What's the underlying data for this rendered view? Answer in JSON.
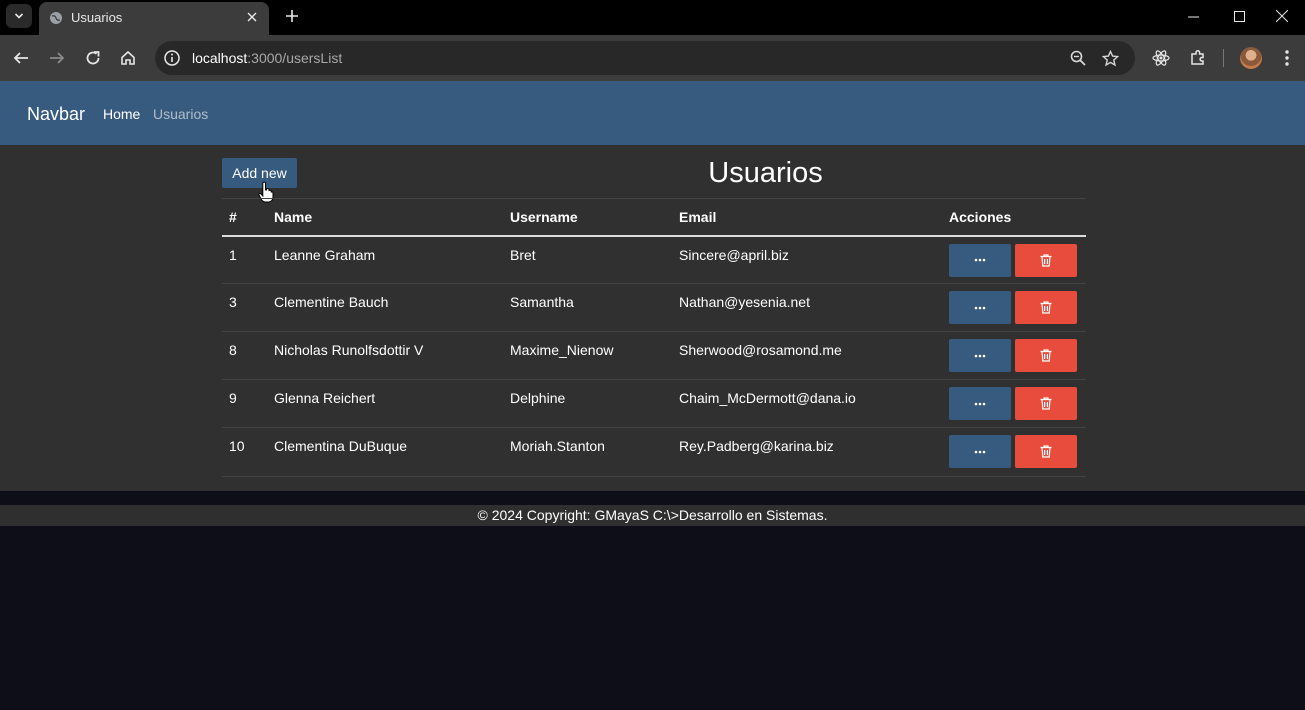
{
  "browser": {
    "tab_title": "Usuarios",
    "url_host": "localhost",
    "url_path": ":3000/usersList"
  },
  "navbar": {
    "brand": "Navbar",
    "links": [
      "Home",
      "Usuarios"
    ]
  },
  "main": {
    "add_button": "Add new",
    "title": "Usuarios",
    "columns": [
      "#",
      "Name",
      "Username",
      "Email",
      "Acciones"
    ],
    "rows": [
      {
        "id": "1",
        "name": "Leanne Graham",
        "username": "Bret",
        "email": "Sincere@april.biz"
      },
      {
        "id": "3",
        "name": "Clementine Bauch",
        "username": "Samantha",
        "email": "Nathan@yesenia.net"
      },
      {
        "id": "8",
        "name": "Nicholas Runolfsdottir V",
        "username": "Maxime_Nienow",
        "email": "Sherwood@rosamond.me"
      },
      {
        "id": "9",
        "name": "Glenna Reichert",
        "username": "Delphine",
        "email": "Chaim_McDermott@dana.io"
      },
      {
        "id": "10",
        "name": "Clementina DuBuque",
        "username": "Moriah.Stanton",
        "email": "Rey.Padberg@karina.biz"
      }
    ],
    "more_button_icon": "ellipsis-icon",
    "delete_button_icon": "trash-icon"
  },
  "footer": {
    "text": "© 2024 Copyright: GMayaS C:\\>Desarrollo en Sistemas."
  },
  "colors": {
    "primary": "#375a7f",
    "danger": "#e74c3c",
    "content_bg": "#303030"
  }
}
